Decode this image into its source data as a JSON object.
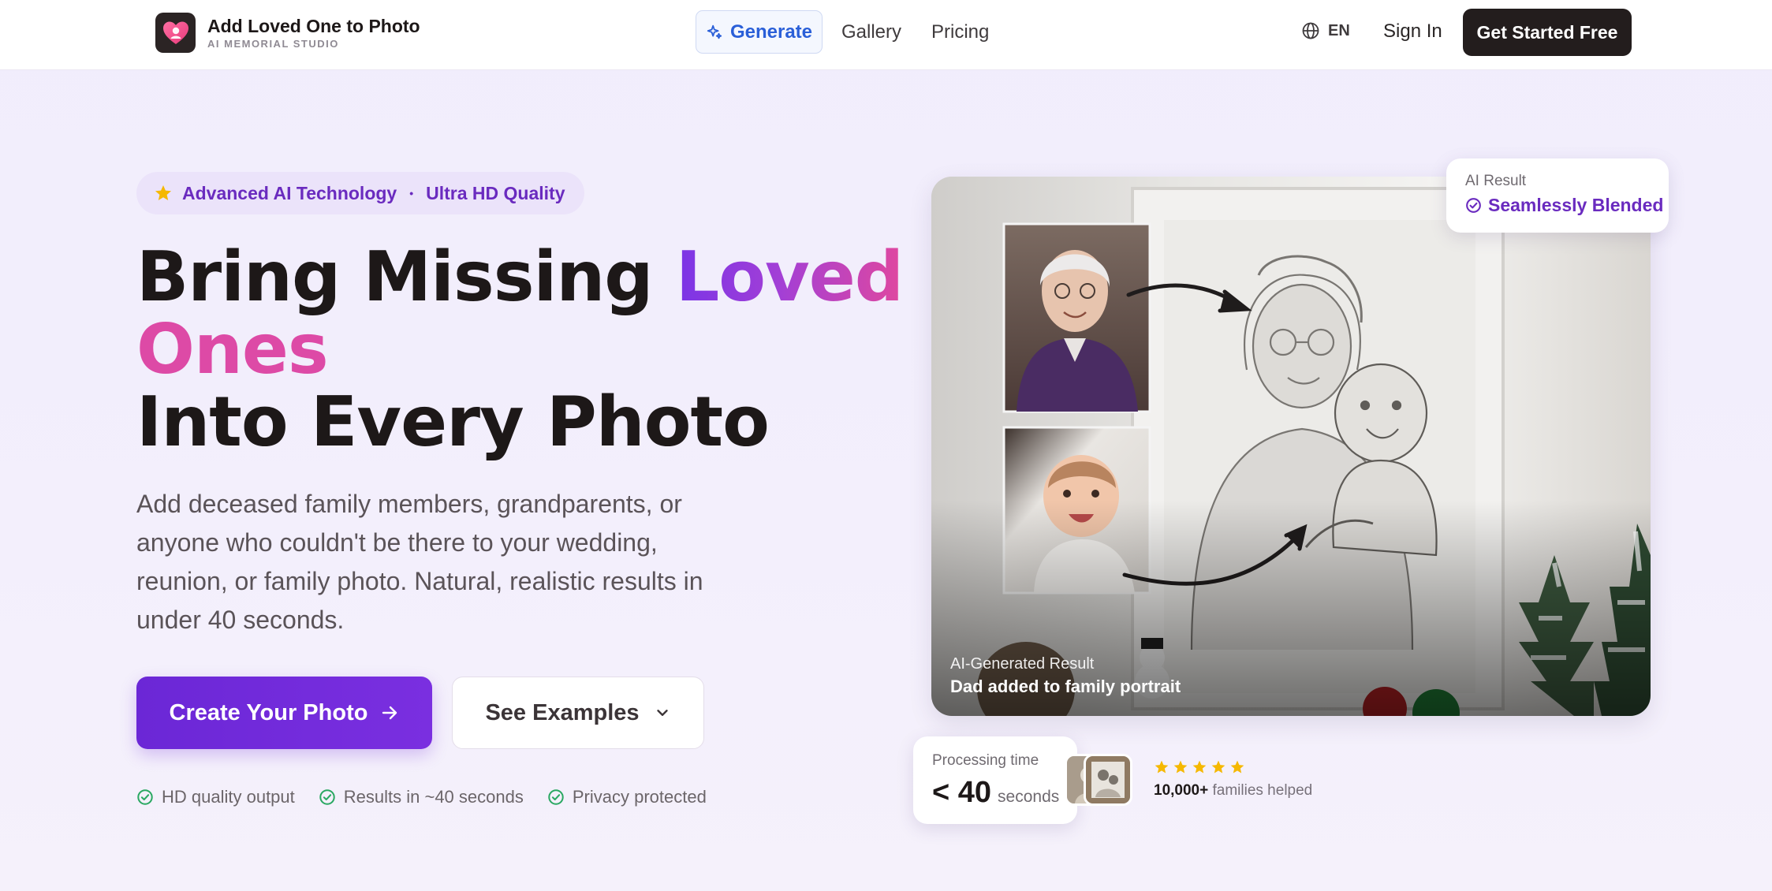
{
  "header": {
    "brand_title": "Add Loved One to Photo",
    "brand_subtitle": "AI MEMORIAL STUDIO",
    "nav": {
      "generate": "Generate",
      "gallery": "Gallery",
      "pricing": "Pricing"
    },
    "language": "EN",
    "sign_in": "Sign In",
    "cta": "Get Started Free"
  },
  "hero": {
    "badge_left": "Advanced AI Technology",
    "badge_separator": "•",
    "badge_right": "Ultra HD Quality",
    "headline_part1": "Bring Missing ",
    "headline_highlight1": "Loved",
    "headline_highlight2": "Ones",
    "headline_line3": "Into Every Photo",
    "description": "Add deceased family members, grandparents, or anyone who couldn't be there to your wedding, reunion, or family photo. Natural, realistic results in under 40 seconds.",
    "primary_button": "Create Your Photo",
    "secondary_button": "See Examples",
    "features": [
      "HD quality output",
      "Results in ~40 seconds",
      "Privacy protected"
    ]
  },
  "showcase": {
    "image_caption_label": "AI-Generated Result",
    "image_caption_title": "Dad added to family portrait",
    "result_card_label": "AI Result",
    "result_card_value": "Seamlessly Blended",
    "processing_label": "Processing time",
    "processing_value": "< 40",
    "processing_unit": "seconds",
    "rating_stars": 5,
    "families_count": "10,000+",
    "families_text": " families helped"
  },
  "colors": {
    "accent_purple": "#6b27d6",
    "accent_blue": "#2a5fd8",
    "star_gold": "#f5b800",
    "check_green": "#2aa862"
  }
}
